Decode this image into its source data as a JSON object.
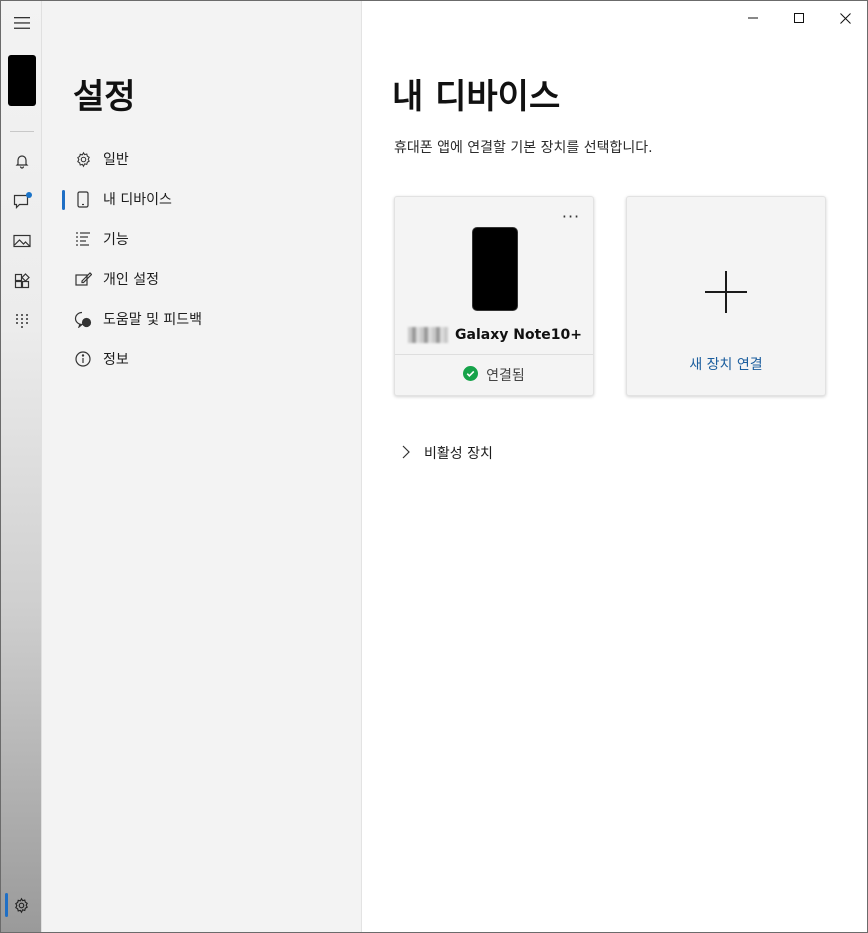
{
  "rail": {
    "items": [
      "menu-icon",
      "phone-thumbnail",
      "bell-icon",
      "messages-icon",
      "photos-icon",
      "apps-icon",
      "dialpad-icon",
      "settings-icon"
    ],
    "accent_color": "#1f6fc5"
  },
  "nav": {
    "title": "설정",
    "items": [
      {
        "label": "일반",
        "icon": "gear-icon"
      },
      {
        "label": "내 디바이스",
        "icon": "phone-icon",
        "selected": true
      },
      {
        "label": "기능",
        "icon": "list-icon"
      },
      {
        "label": "개인 설정",
        "icon": "edit-icon"
      },
      {
        "label": "도움말 및 피드백",
        "icon": "help-icon"
      },
      {
        "label": "정보",
        "icon": "info-icon"
      }
    ]
  },
  "main": {
    "title": "내 디바이스",
    "subtitle": "휴대폰 앱에 연결할 기본 장치를 선택합니다.",
    "device_card": {
      "name": "Galaxy Note10+",
      "more_label": "···",
      "status": "연결됨",
      "status_color": "#16a34a"
    },
    "add_card": {
      "label": "새 장치 연결",
      "label_color": "#1b5e9e"
    },
    "inactive_label": "비활성 장치"
  }
}
